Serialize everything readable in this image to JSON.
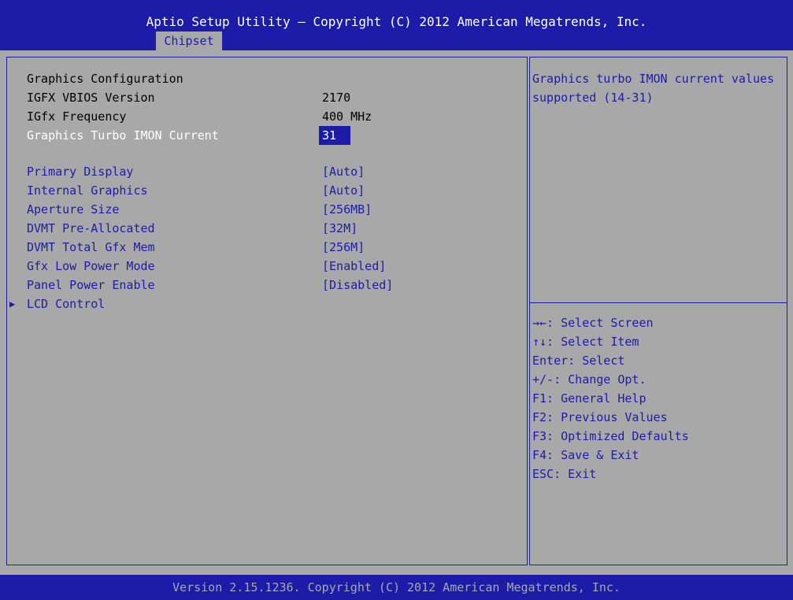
{
  "header": {
    "title": "Aptio Setup Utility – Copyright (C) 2012 American Megatrends, Inc.",
    "active_tab": "Chipset"
  },
  "main": {
    "info_rows": [
      {
        "label": "Graphics Configuration",
        "value": ""
      },
      {
        "label": "IGFX VBIOS Version",
        "value": "2170"
      },
      {
        "label": "IGfx Frequency",
        "value": "400 MHz"
      }
    ],
    "selected_row": {
      "label": "Graphics Turbo IMON Current",
      "value": "31"
    },
    "config_rows": [
      {
        "label": "Primary Display",
        "value": "[Auto]"
      },
      {
        "label": "Internal Graphics",
        "value": "[Auto]"
      },
      {
        "label": "Aperture Size",
        "value": "[256MB]"
      },
      {
        "label": "DVMT Pre-Allocated",
        "value": "[32M]"
      },
      {
        "label": "DVMT Total Gfx Mem",
        "value": "[256M]"
      },
      {
        "label": "Gfx Low Power Mode",
        "value": "[Enabled]"
      },
      {
        "label": "Panel Power Enable",
        "value": "[Disabled]"
      }
    ],
    "submenu": {
      "arrow": "▶",
      "label": "LCD Control"
    }
  },
  "help": {
    "description": "Graphics turbo IMON current values supported (14-31)",
    "keys": [
      "→←: Select Screen",
      "↑↓: Select Item",
      "Enter: Select",
      "+/-: Change Opt.",
      "F1: General Help",
      "F2: Previous Values",
      "F3: Optimized Defaults",
      "F4: Save & Exit",
      "ESC: Exit"
    ]
  },
  "footer": {
    "text": "Version 2.15.1236. Copyright (C) 2012 American Megatrends, Inc."
  },
  "colors": {
    "background": "#a8a8a8",
    "bios_blue": "#1c1ca8",
    "highlight_text": "#ffffff"
  }
}
